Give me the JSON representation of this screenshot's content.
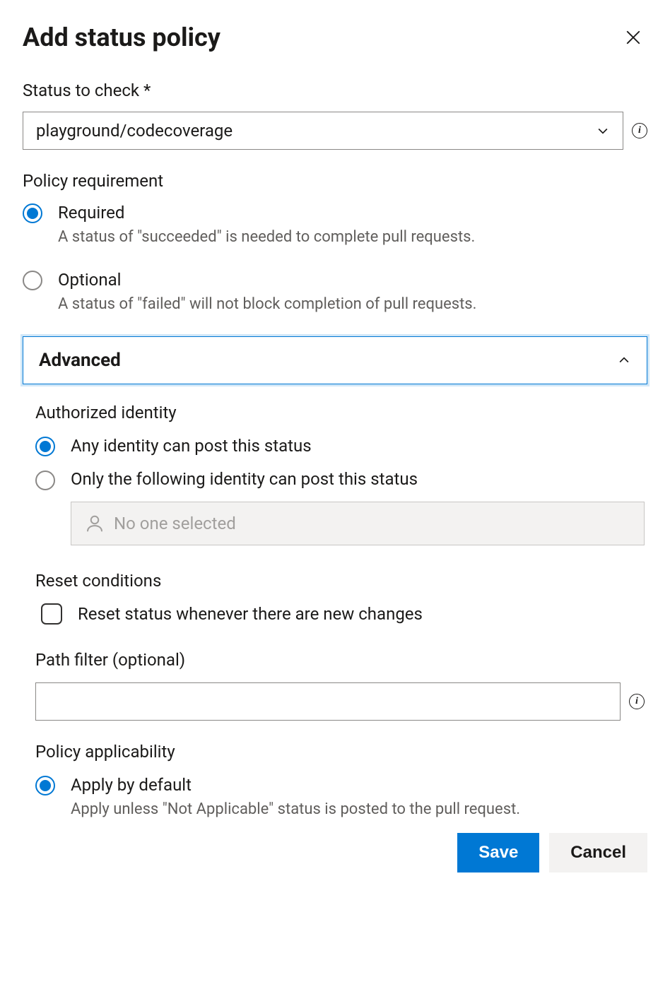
{
  "dialog": {
    "title": "Add status policy"
  },
  "status_to_check": {
    "label": "Status to check *",
    "value": "playground/codecoverage"
  },
  "policy_requirement": {
    "heading": "Policy requirement",
    "required": {
      "label": "Required",
      "desc": "A status of \"succeeded\" is needed to complete pull requests.",
      "selected": true
    },
    "optional": {
      "label": "Optional",
      "desc": "A status of \"failed\" will not block completion of pull requests.",
      "selected": false
    }
  },
  "advanced": {
    "heading": "Advanced",
    "authorized_identity": {
      "heading": "Authorized identity",
      "any": {
        "label": "Any identity can post this status",
        "selected": true
      },
      "specific": {
        "label": "Only the following identity can post this status",
        "selected": false
      },
      "picker_placeholder": "No one selected"
    },
    "reset_conditions": {
      "heading": "Reset conditions",
      "checkbox_label": "Reset status whenever there are new changes",
      "checked": false
    },
    "path_filter": {
      "heading": "Path filter (optional)",
      "value": ""
    },
    "policy_applicability": {
      "heading": "Policy applicability",
      "apply_default": {
        "label": "Apply by default",
        "desc": "Apply unless \"Not Applicable\" status is posted to the pull request.",
        "selected": true
      }
    }
  },
  "footer": {
    "save": "Save",
    "cancel": "Cancel"
  }
}
